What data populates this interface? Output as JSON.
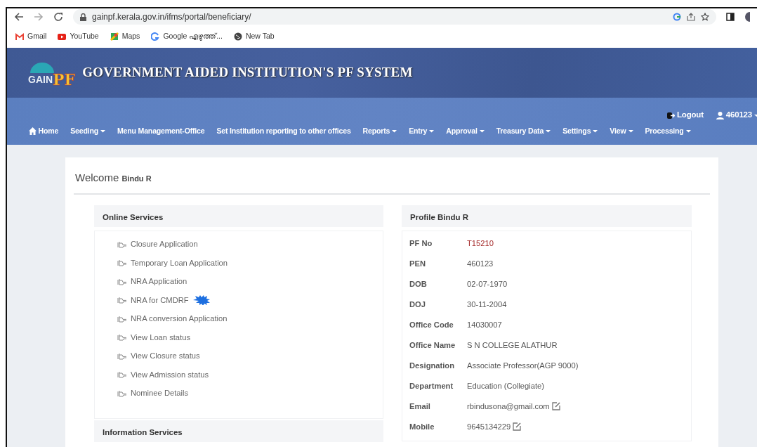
{
  "browser": {
    "url": "gainpf.kerala.gov.in/ifms/portal/beneficiary/",
    "bookmarks": [
      {
        "kind": "gmail",
        "label": "Gmail"
      },
      {
        "kind": "youtube",
        "label": "YouTube"
      },
      {
        "kind": "maps",
        "label": "Maps"
      },
      {
        "kind": "google",
        "label": "Google എഴുത്ത്..."
      },
      {
        "kind": "globe",
        "label": "New Tab"
      }
    ]
  },
  "header": {
    "logo_left": "GAIN",
    "logo_right": "PF",
    "title": "GOVERNMENT AIDED INSTITUTION'S PF SYSTEM"
  },
  "user_bar": {
    "logout": "Logout",
    "user": "460123"
  },
  "nav": [
    {
      "label": "Home",
      "kind": "home",
      "has_caret": false
    },
    {
      "label": "Seeding",
      "kind": "menu",
      "has_caret": true
    },
    {
      "label": "Menu Management-Office",
      "kind": "link",
      "has_caret": false
    },
    {
      "label": "Set Institution reporting to other offices",
      "kind": "link",
      "has_caret": false
    },
    {
      "label": "Reports",
      "kind": "menu",
      "has_caret": true
    },
    {
      "label": "Entry",
      "kind": "menu",
      "has_caret": true
    },
    {
      "label": "Approval",
      "kind": "menu",
      "has_caret": true
    },
    {
      "label": "Treasury Data",
      "kind": "menu",
      "has_caret": true
    },
    {
      "label": "Settings",
      "kind": "menu",
      "has_caret": true
    },
    {
      "label": "View",
      "kind": "menu",
      "has_caret": true
    },
    {
      "label": "Processing",
      "kind": "menu",
      "has_caret": true
    }
  ],
  "welcome": {
    "greeting": "Welcome",
    "name": "Bindu R"
  },
  "online_services": {
    "title": "Online Services",
    "items": [
      {
        "label": "Closure Application",
        "is_new": false
      },
      {
        "label": "Temporary Loan Application",
        "is_new": false
      },
      {
        "label": "NRA Application",
        "is_new": false
      },
      {
        "label": "NRA for CMDRF",
        "is_new": true
      },
      {
        "label": "NRA conversion Application",
        "is_new": false
      },
      {
        "label": "View Loan status",
        "is_new": false
      },
      {
        "label": "View Closure status",
        "is_new": false
      },
      {
        "label": "View Admission status",
        "is_new": false
      },
      {
        "label": "Nominee Details",
        "is_new": false
      }
    ]
  },
  "information_services": {
    "title": "Information Services"
  },
  "profile": {
    "title": "Profile Bindu R",
    "rows": [
      {
        "label": "PF No",
        "value": "T15210",
        "highlighted": true,
        "editable": false
      },
      {
        "label": "PEN",
        "value": "460123",
        "highlighted": false,
        "editable": false
      },
      {
        "label": "DOB",
        "value": "02-07-1970",
        "highlighted": false,
        "editable": false
      },
      {
        "label": "DOJ",
        "value": "30-11-2004",
        "highlighted": false,
        "editable": false
      },
      {
        "label": "Office Code",
        "value": "14030007",
        "highlighted": false,
        "editable": false
      },
      {
        "label": "Office Name",
        "value": "S N COLLEGE ALATHUR",
        "highlighted": false,
        "editable": false
      },
      {
        "label": "Designation",
        "value": "Associate Professor(AGP 9000)",
        "highlighted": false,
        "editable": false
      },
      {
        "label": "Department",
        "value": "Education (Collegiate)",
        "highlighted": false,
        "editable": false
      },
      {
        "label": "Email",
        "value": "rbindusona@gmail.com",
        "highlighted": false,
        "editable": true
      },
      {
        "label": "Mobile",
        "value": "9645134229",
        "highlighted": false,
        "editable": true
      }
    ]
  }
}
